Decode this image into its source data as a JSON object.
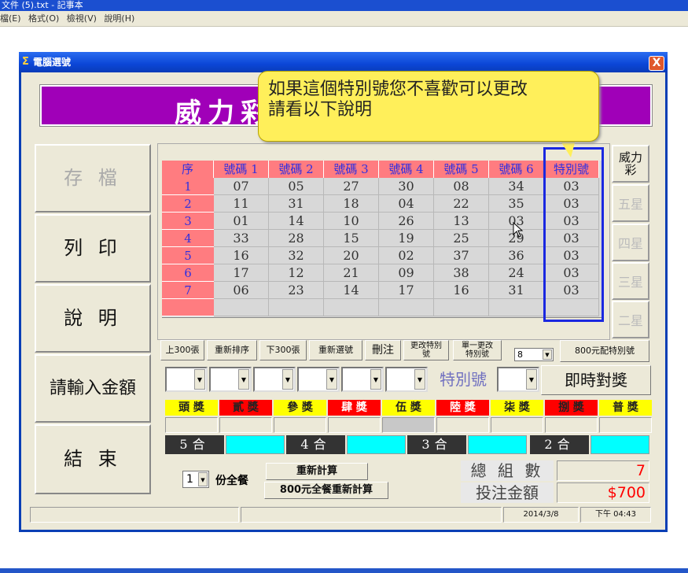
{
  "notepad": {
    "title": "文件 (5).txt - 記事本",
    "menu": [
      "檔(E)",
      "格式(O)",
      "檢視(V)",
      "說明(H)"
    ]
  },
  "window": {
    "title": "電腦選號",
    "close": "X",
    "icon": "Σ"
  },
  "banner": {
    "text": "威力彩"
  },
  "tooltip": {
    "line1": "如果這個特別號您不喜歡可以更改",
    "line2": "請看以下說明"
  },
  "left_buttons": [
    "存 檔",
    "列 印",
    "說 明",
    "請輸入金額",
    "結 束"
  ],
  "grid": {
    "headers": [
      "序",
      "號碼 1",
      "號碼 2",
      "號碼 3",
      "號碼 4",
      "號碼 5",
      "號碼 6",
      "特別號"
    ],
    "rows": [
      [
        "1",
        "07",
        "05",
        "27",
        "30",
        "08",
        "34",
        "03"
      ],
      [
        "2",
        "11",
        "31",
        "18",
        "04",
        "22",
        "35",
        "03"
      ],
      [
        "3",
        "01",
        "14",
        "10",
        "26",
        "13",
        "03",
        "03"
      ],
      [
        "4",
        "33",
        "28",
        "15",
        "19",
        "25",
        "29",
        "03"
      ],
      [
        "5",
        "16",
        "32",
        "20",
        "02",
        "37",
        "36",
        "03"
      ],
      [
        "6",
        "17",
        "12",
        "21",
        "09",
        "38",
        "24",
        "03"
      ],
      [
        "7",
        "06",
        "23",
        "14",
        "17",
        "16",
        "31",
        "03"
      ],
      [
        "",
        "",
        "",
        "",
        "",
        "",
        "",
        ""
      ]
    ]
  },
  "right_tabs": [
    "威力彩",
    "五星",
    "四星",
    "三星",
    "二星"
  ],
  "toolbar": {
    "prev300": "上300張",
    "resort": "重新排序",
    "next300": "下300張",
    "reselect": "重新選號",
    "delete": "刪注",
    "change_special": "更改特別號",
    "single_change_special": "單一更改特別號",
    "count_value": "8",
    "special_800": "800元配特別號"
  },
  "picker": {
    "special_label": "特別號",
    "instant_check": "即時對獎"
  },
  "prizes": [
    {
      "label": "頭 獎",
      "bg": "#ffff00",
      "fg": "#222222"
    },
    {
      "label": "貳 獎",
      "bg": "#ff0000",
      "fg": "#222222"
    },
    {
      "label": "參 獎",
      "bg": "#ffff00",
      "fg": "#222222"
    },
    {
      "label": "肆 獎",
      "bg": "#ff0000",
      "fg": "#ffffff"
    },
    {
      "label": "伍 獎",
      "bg": "#ffff00",
      "fg": "#222222"
    },
    {
      "label": "陸 獎",
      "bg": "#ff0000",
      "fg": "#ffffff"
    },
    {
      "label": "柒 獎",
      "bg": "#ffff00",
      "fg": "#222222"
    },
    {
      "label": "捌 獎",
      "bg": "#ff0000",
      "fg": "#222222"
    },
    {
      "label": "普 獎",
      "bg": "#ffff00",
      "fg": "#222222"
    }
  ],
  "matches": [
    "5合",
    "4合",
    "3合",
    "2合"
  ],
  "bottom": {
    "qty_value": "1",
    "full_set_label": "份全餐",
    "recalc": "重新計算",
    "recalc_800": "800元全餐重新計算",
    "total_groups_label": "總 組 數",
    "total_groups_value": "7",
    "amount_label": "投注金額",
    "amount_value": "$700"
  },
  "status": {
    "date": "2014/3/8",
    "time": "下午 04:43"
  },
  "colors": {
    "banner": "#a000b8",
    "header": "#ff7c80",
    "tooltip": "#ffef5a",
    "highlight_border": "#1a28e0",
    "value_red": "#ff0000"
  }
}
